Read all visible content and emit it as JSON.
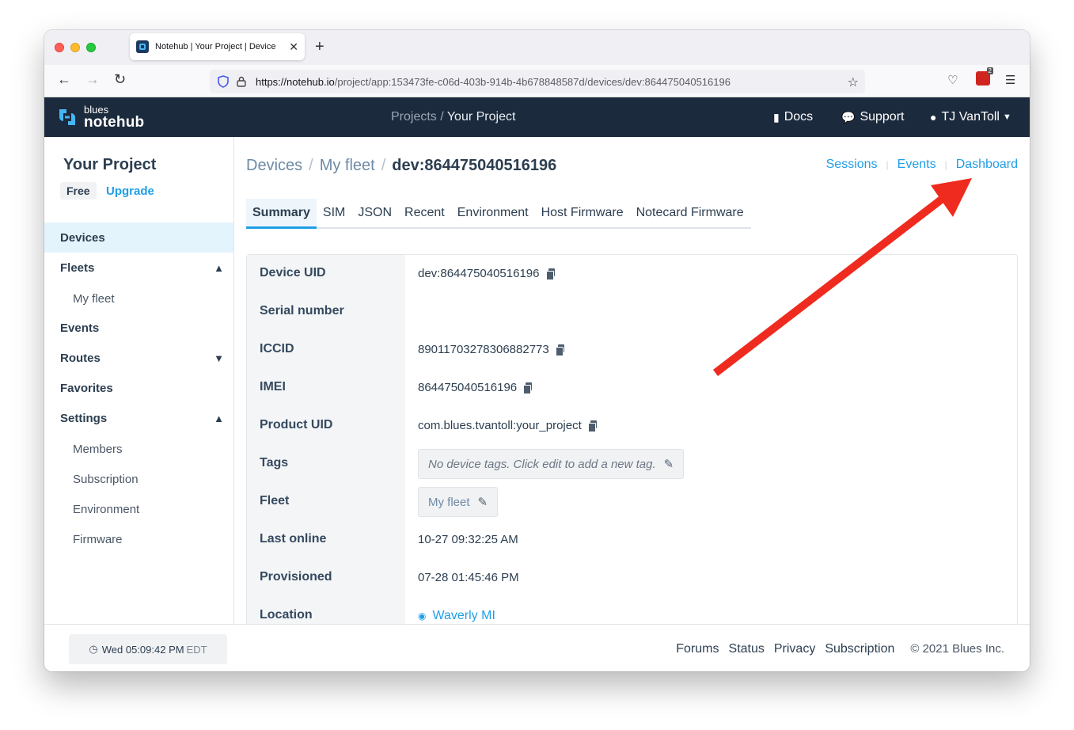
{
  "browser": {
    "tab_title": "Notehub | Your Project | Device",
    "url_host": "https://notehub.io",
    "url_path": "/project/app:153473fe-c06d-403b-914b-4b678848587d/devices/dev:864475040516196",
    "ext_badge_count": "2"
  },
  "header": {
    "logo_small": "blues",
    "logo_big": "notehub",
    "crumb_projects": "Projects /",
    "crumb_current": "Your Project",
    "docs": "Docs",
    "support": "Support",
    "user": "TJ VanToll"
  },
  "sidebar": {
    "project_name": "Your Project",
    "plan": "Free",
    "upgrade": "Upgrade",
    "items": [
      {
        "label": "Devices"
      },
      {
        "label": "Fleets"
      },
      {
        "label": "My fleet"
      },
      {
        "label": "Events"
      },
      {
        "label": "Routes"
      },
      {
        "label": "Favorites"
      },
      {
        "label": "Settings"
      },
      {
        "label": "Members"
      },
      {
        "label": "Subscription"
      },
      {
        "label": "Environment"
      },
      {
        "label": "Firmware"
      }
    ]
  },
  "main": {
    "breadcrumb": {
      "devices": "Devices",
      "fleet": "My fleet",
      "device": "dev:864475040516196"
    },
    "top_links": {
      "sessions": "Sessions",
      "events": "Events",
      "dashboard": "Dashboard"
    },
    "tabs": [
      "Summary",
      "SIM",
      "JSON",
      "Recent",
      "Environment",
      "Host Firmware",
      "Notecard Firmware"
    ],
    "fields": {
      "device_uid": {
        "label": "Device UID",
        "value": "dev:864475040516196"
      },
      "serial": {
        "label": "Serial number",
        "value": ""
      },
      "iccid": {
        "label": "ICCID",
        "value": "89011703278306882773"
      },
      "imei": {
        "label": "IMEI",
        "value": "864475040516196"
      },
      "product_uid": {
        "label": "Product UID",
        "value": "com.blues.tvantoll:your_project"
      },
      "tags": {
        "label": "Tags",
        "value": "No device tags. Click edit to add a new tag."
      },
      "fleet": {
        "label": "Fleet",
        "value": "My fleet"
      },
      "last_online": {
        "label": "Last online",
        "value": "10-27 09:32:25 AM"
      },
      "provisioned": {
        "label": "Provisioned",
        "value": "07-28 01:45:46 PM"
      },
      "location": {
        "label": "Location",
        "value": "Waverly MI"
      }
    }
  },
  "footer": {
    "clock": "Wed 05:09:42 PM",
    "tz": "EDT",
    "links": [
      "Forums",
      "Status",
      "Privacy",
      "Subscription"
    ],
    "copyright": "© 2021 Blues Inc."
  },
  "colors": {
    "accent": "#1f9ee6",
    "header_bg": "#1b2a3c",
    "annotation_arrow": "#ef2b1f"
  }
}
